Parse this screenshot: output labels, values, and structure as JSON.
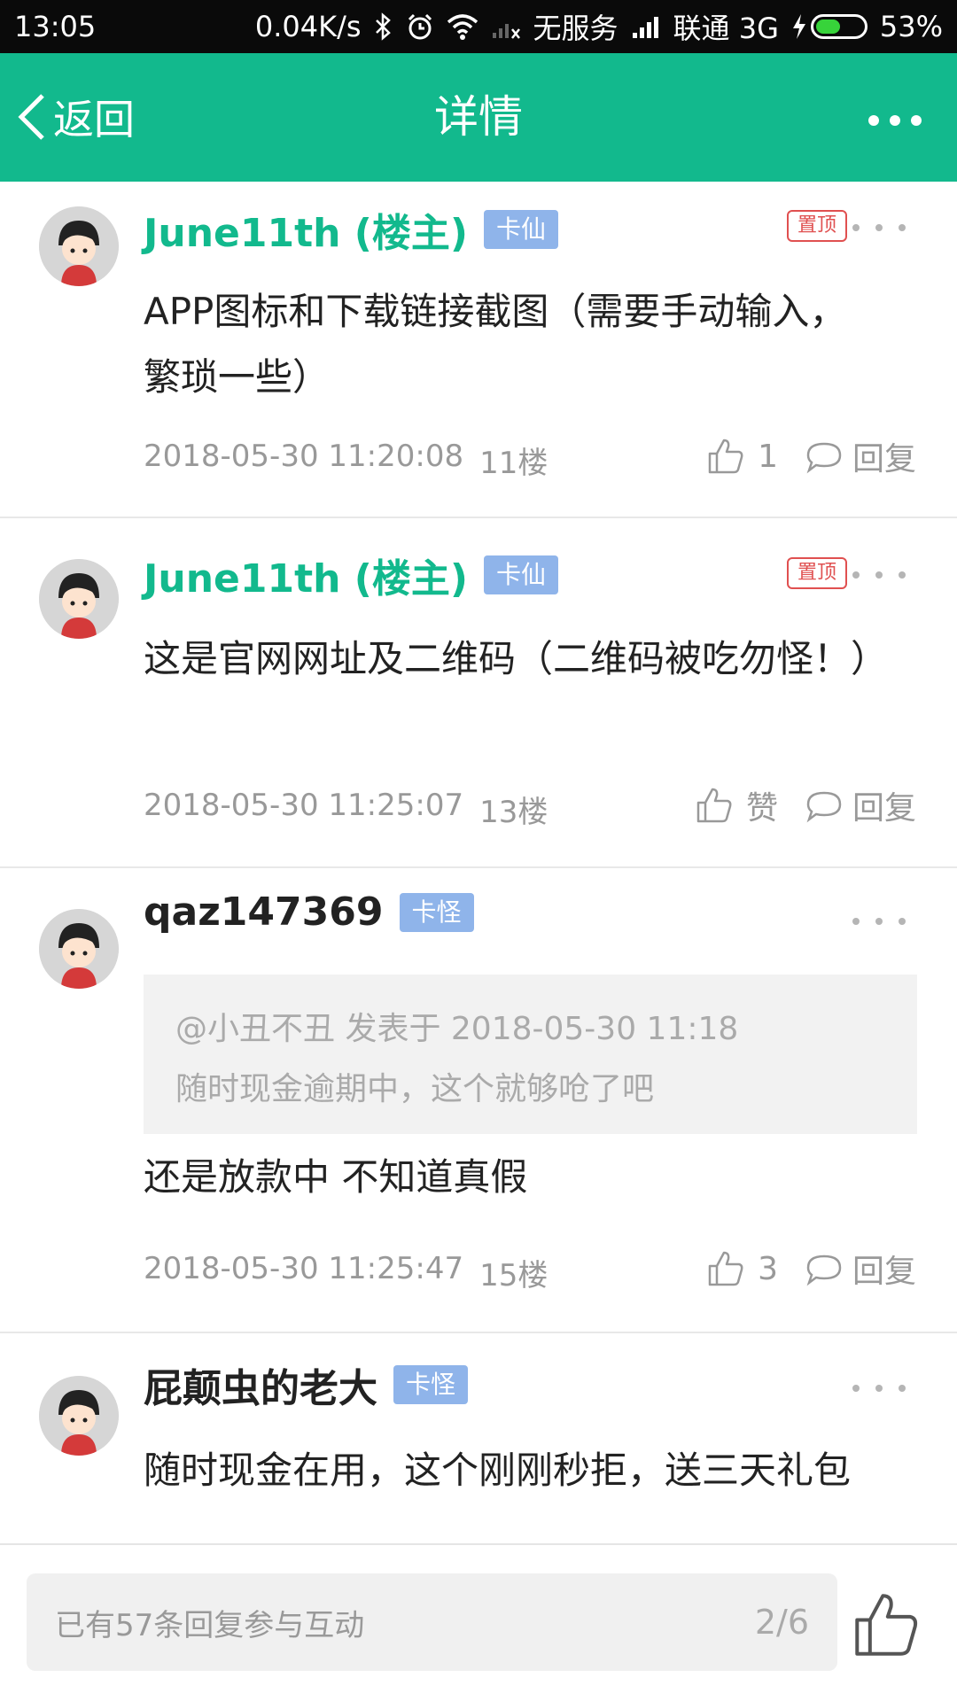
{
  "status_bar": {
    "time": "13:05",
    "speed": "0.04K/s",
    "no_service": "无服务",
    "carrier": "联通 3G",
    "battery": "53%",
    "battery_level": 0.53
  },
  "header": {
    "back_label": "返回",
    "title": "详情"
  },
  "posts": [
    {
      "author": "June11th (楼主)",
      "badge": "卡仙",
      "pinned_label": "置顶",
      "content": "APP图标和下载链接截图（需要手动输入，繁琐一些）",
      "timestamp": "2018-05-30 11:20:08",
      "floor": "11楼",
      "likes": "1",
      "reply_label": "回复"
    },
    {
      "author": "June11th (楼主)",
      "badge": "卡仙",
      "pinned_label": "置顶",
      "content": "这是官网网址及二维码（二维码被吃勿怪！）",
      "timestamp": "2018-05-30 11:25:07",
      "floor": "13楼",
      "likes": "赞",
      "reply_label": "回复"
    },
    {
      "author": "qaz147369",
      "badge": "卡怪",
      "quote_header": "@小丑不丑 发表于 2018-05-30 11:18",
      "quote_text": "随时现金逾期中，这个就够呛了吧",
      "content": "还是放款中   不知道真假",
      "timestamp": "2018-05-30 11:25:47",
      "floor": "15楼",
      "likes": "3",
      "reply_label": "回复"
    },
    {
      "author": "屁颠虫的老大",
      "badge": "卡怪",
      "content": "随时现金在用，这个刚刚秒拒，送三天礼包"
    }
  ],
  "bottom_bar": {
    "placeholder": "已有57条回复参与互动",
    "pager": "2/6"
  },
  "colors": {
    "brand": "#12b98d",
    "badge": "#8fb4ea",
    "pin": "#e05050"
  }
}
